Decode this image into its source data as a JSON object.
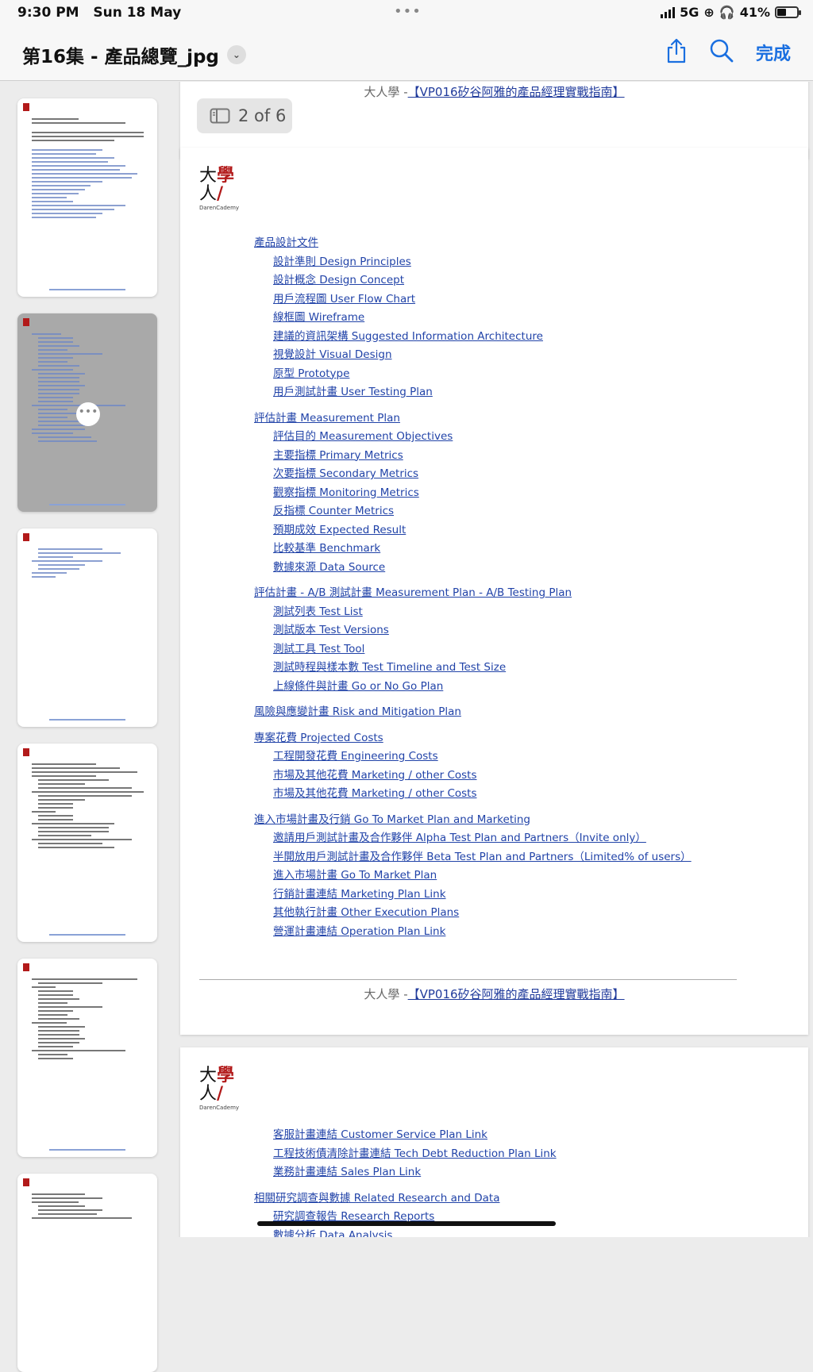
{
  "status_bar": {
    "time": "9:30 PM",
    "date": "Sun 18 May",
    "network": "5G",
    "battery": "41%"
  },
  "navbar": {
    "title": "第16集 - 產品總覽_jpg",
    "done_label": "完成"
  },
  "page_counter": "2 of 6",
  "footer": {
    "prefix": "大人學 -",
    "link": "【VP016矽谷阿雅的產品經理實戰指南】"
  },
  "logo": {
    "top": "大學",
    "side": "人",
    "brand": "DarenCademy"
  },
  "page2_toc": [
    {
      "text": "產品設計文件",
      "level": 1
    },
    {
      "text": "設計準則 Design Principles",
      "level": 2
    },
    {
      "text": "設計概念 Design Concept",
      "level": 2
    },
    {
      "text": "用戶流程圖 User Flow Chart",
      "level": 2
    },
    {
      "text": "線框圖 Wireframe",
      "level": 2
    },
    {
      "text": "建議的資訊架構 Suggested Information Architecture",
      "level": 2
    },
    {
      "text": "視覺設計 Visual Design",
      "level": 2
    },
    {
      "text": "原型 Prototype",
      "level": 2
    },
    {
      "text": "用戶測試計畫 User Testing Plan",
      "level": 2
    },
    {
      "text": "評估計畫 Measurement Plan",
      "level": 1
    },
    {
      "text": "評估目的 Measurement Objectives",
      "level": 2
    },
    {
      "text": "主要指標 Primary Metrics",
      "level": 2
    },
    {
      "text": "次要指標 Secondary Metrics",
      "level": 2
    },
    {
      "text": "觀察指標 Monitoring Metrics",
      "level": 2
    },
    {
      "text": "反指標 Counter Metrics",
      "level": 2
    },
    {
      "text": "預期成效 Expected Result",
      "level": 2
    },
    {
      "text": "比較基準 Benchmark",
      "level": 2
    },
    {
      "text": "數據來源 Data Source",
      "level": 2
    },
    {
      "text": "評估計畫 - A/B 測試計畫 Measurement Plan - A/B Testing Plan",
      "level": 1
    },
    {
      "text": "測試列表 Test List",
      "level": 2
    },
    {
      "text": "測試版本 Test Versions",
      "level": 2
    },
    {
      "text": "測試工具 Test Tool",
      "level": 2
    },
    {
      "text": "測試時程與樣本數 Test Timeline and Test Size",
      "level": 2
    },
    {
      "text": "上線條件與計畫 Go or No Go Plan",
      "level": 2
    },
    {
      "text": "風險與應變計畫 Risk and Mitigation Plan",
      "level": 1
    },
    {
      "text": "專案花費 Projected Costs",
      "level": 1
    },
    {
      "text": "工程開發花費 Engineering Costs",
      "level": 2
    },
    {
      "text": "市場及其他花費 Marketing / other Costs",
      "level": 2
    },
    {
      "text": "市場及其他花費 Marketing / other Costs",
      "level": 2
    },
    {
      "text": "進入市場計畫及行銷 Go To Market Plan and Marketing",
      "level": 1
    },
    {
      "text": "邀請用戶測試計畫及合作夥伴 Alpha Test Plan and Partners（Invite only）",
      "level": 2
    },
    {
      "text": "半開放用戶測試計畫及合作夥伴 Beta Test Plan and Partners（Limited% of users）",
      "level": 2
    },
    {
      "text": "進入市場計畫 Go To Market Plan",
      "level": 2
    },
    {
      "text": "行銷計畫連結 Marketing Plan Link",
      "level": 2
    },
    {
      "text": "其他執行計畫 Other Execution Plans",
      "level": 2
    },
    {
      "text": "營運計畫連結 Operation Plan Link",
      "level": 2
    }
  ],
  "page3_toc": [
    {
      "text": "客服計畫連結 Customer Service Plan Link",
      "level": 2
    },
    {
      "text": "工程技術債清除計畫連結 Tech Debt Reduction Plan Link",
      "level": 2
    },
    {
      "text": "業務計畫連結 Sales Plan Link",
      "level": 2
    },
    {
      "text": "相關研究調查與數據 Related Research and Data",
      "level": 1
    },
    {
      "text": "研究調查報告 Research Reports",
      "level": 2
    },
    {
      "text": "數據分析 Data Analysis",
      "level": 2
    }
  ],
  "thumbnails": [
    {
      "page": 1,
      "selected": false
    },
    {
      "page": 2,
      "selected": true,
      "more": "•••"
    },
    {
      "page": 3,
      "selected": false
    },
    {
      "page": 4,
      "selected": false
    },
    {
      "page": 5,
      "selected": false
    },
    {
      "page": 6,
      "selected": false
    }
  ],
  "colors": {
    "link": "#2143a8",
    "accent": "#1a6fe0",
    "logo_red": "#b21a1a"
  }
}
